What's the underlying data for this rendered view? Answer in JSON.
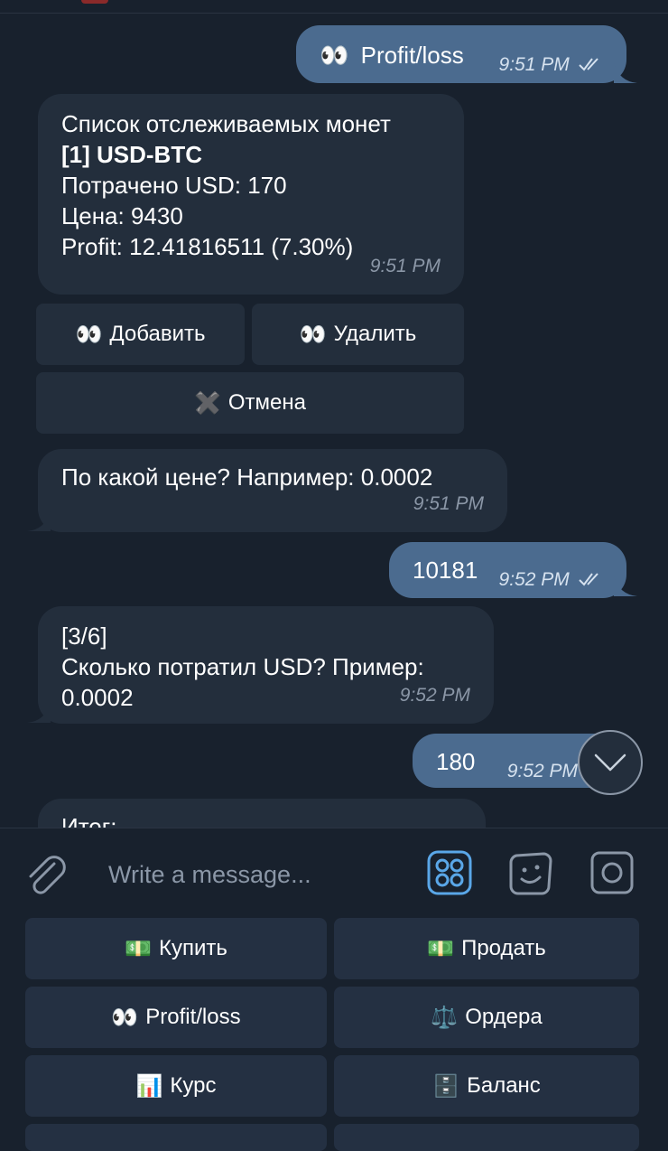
{
  "messages": {
    "m1": {
      "text": "Profit/loss",
      "emoji": "👀",
      "time": "9:51 PM"
    },
    "m2": {
      "line1": "Список отслеживаемых монет",
      "line2": "[1] USD-BTC",
      "line3": "Потрачено USD: 170",
      "line4": "Цена: 9430",
      "line5": "Profit: 12.41816511 (7.30%)",
      "time": "9:51 PM"
    },
    "m3": {
      "text": "По какой цене? Например: 0.0002",
      "time": "9:51 PM"
    },
    "m4": {
      "text": "10181",
      "time": "9:52 PM"
    },
    "m5": {
      "line1": "[3/6]",
      "line2": "Сколько потратил USD? Пример:",
      "line3": "0.0002",
      "time": "9:52 PM"
    },
    "m6": {
      "text": "180",
      "time": "9:52 PM"
    },
    "m7": {
      "text": "Итог:"
    }
  },
  "inline_keyboard": {
    "add": {
      "emoji": "👀",
      "label": "Добавить"
    },
    "remove": {
      "emoji": "👀",
      "label": "Удалить"
    },
    "cancel": {
      "emoji": "✖️",
      "label": "Отмена"
    }
  },
  "input": {
    "placeholder": "Write a message..."
  },
  "reply_keyboard": [
    {
      "emoji": "💵",
      "label": "Купить"
    },
    {
      "emoji": "💵",
      "label": "Продать"
    },
    {
      "emoji": "👀",
      "label": "Profit/loss"
    },
    {
      "emoji": "⚖️",
      "label": "Ордера"
    },
    {
      "emoji": "📊",
      "label": "Курс"
    },
    {
      "emoji": "🗄️",
      "label": "Баланс"
    }
  ],
  "icons": {
    "attach": "paperclip-icon",
    "bot_commands": "grid-icon",
    "sticker": "sticker-icon",
    "camera": "camera-icon",
    "scroll": "chevron-down-icon",
    "read": "double-check-icon"
  },
  "colors": {
    "background": "#18212d",
    "incoming_bubble": "#232e3c",
    "outgoing_bubble": "#4b6b8f",
    "accent": "#5aa7e8",
    "muted": "#8b97a7"
  }
}
